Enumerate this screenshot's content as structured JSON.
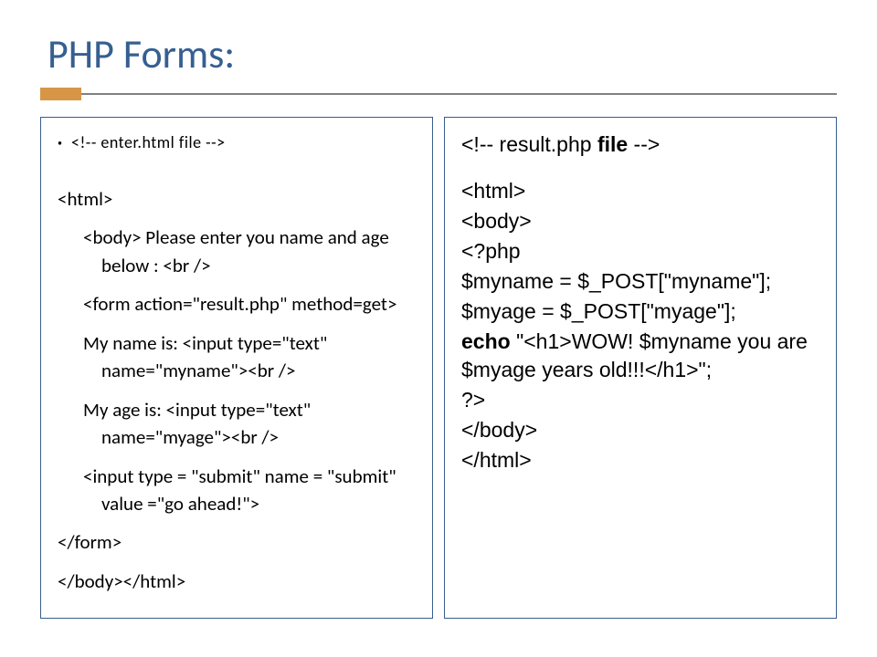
{
  "title": "PHP Forms:",
  "left": {
    "l1": "<!-- enter.html file -->",
    "l2": "<html>",
    "l3": "<body>   Please enter you name and age below : <br />",
    "l4": "<form action=\"result.php\" method=get>",
    "l5": "My name is:   <input type=\"text\" name=\"myname\"><br />",
    "l6": " My age is:  <input type=\"text\" name=\"myage\"><br />",
    "l7": "<input type = \"submit\" name = \"submit\" value =\"go ahead!\">",
    "l8": "</form>",
    "l9": "</body></html>"
  },
  "right": {
    "r1a": "<!-- result.php ",
    "r1b": "file",
    "r1c": " -->",
    "r2": "<html>",
    "r3": "<body>",
    "r4": "<?php",
    "r5": "$myname = $_POST[\"myname\"];",
    "r6": "$myage = $_POST[\"myage\"];",
    "r7a": "echo ",
    "r7b": "\"<h1>WOW! $myname you are $myage years old!!!</h1>\";",
    "r8": "?>",
    "r9": "</body>",
    "r10": "</html>"
  }
}
